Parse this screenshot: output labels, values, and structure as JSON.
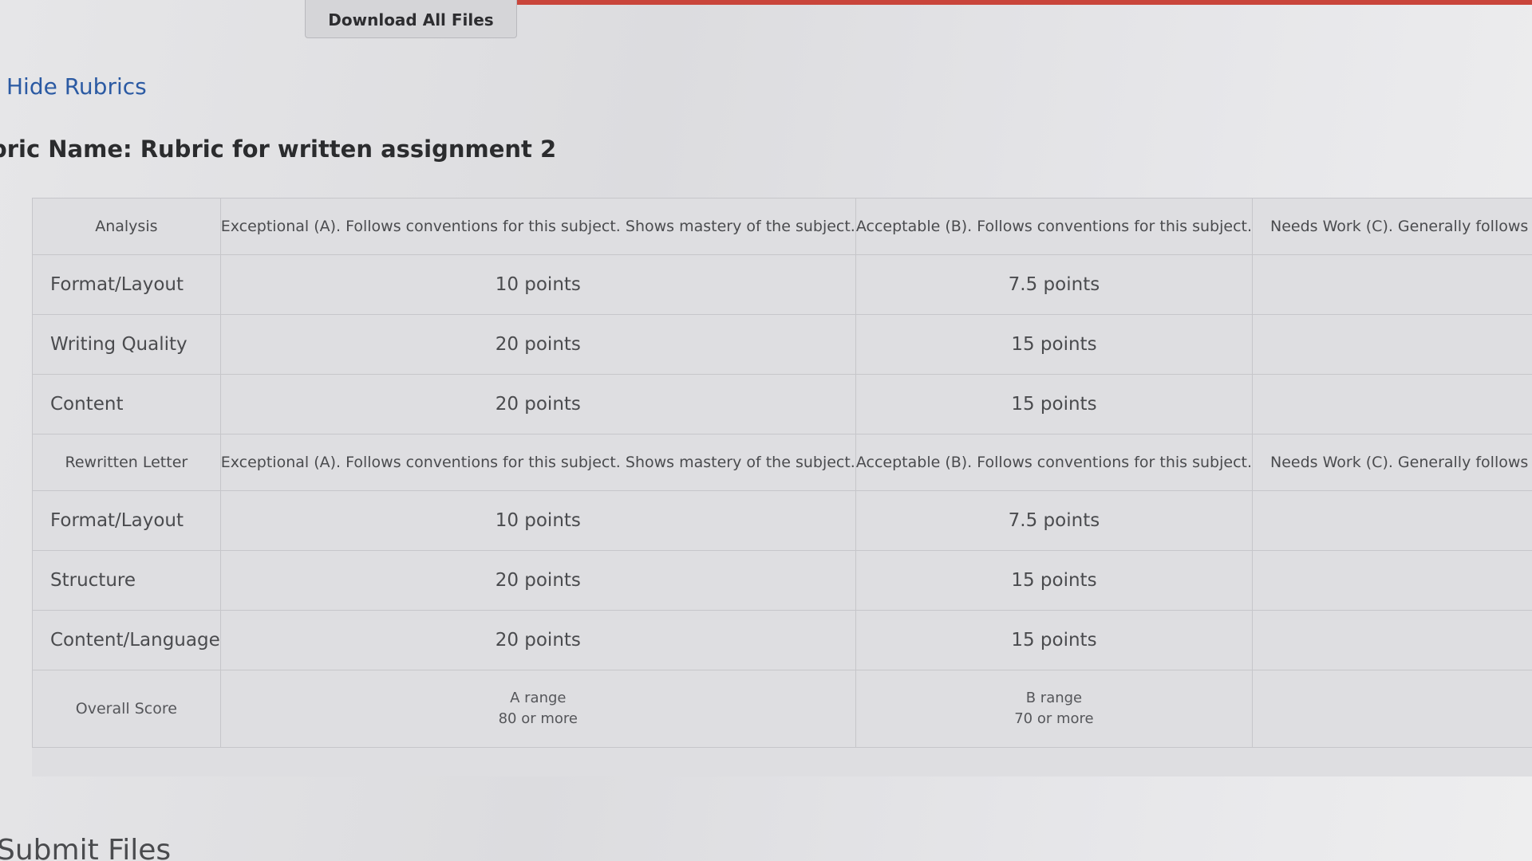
{
  "toolbar": {
    "download_label": "Download All Files"
  },
  "rubrics_toggle": {
    "label": "Hide Rubrics"
  },
  "rubric": {
    "name": "bric Name: Rubric for written assignment 2",
    "sections": [
      {
        "title": "Analysis",
        "levels": [
          "Exceptional (A). Follows conventions for this subject. Shows mastery of the subject.",
          "Acceptable (B). Follows conventions for this subject.",
          "Needs Work (C). Generally follows the c"
        ],
        "rows": [
          {
            "criterion": "Format/Layout",
            "scores": [
              "10 points",
              "7.5 points",
              ""
            ]
          },
          {
            "criterion": "Writing Quality",
            "scores": [
              "20 points",
              "15 points",
              ""
            ]
          },
          {
            "criterion": "Content",
            "scores": [
              "20 points",
              "15 points",
              ""
            ]
          }
        ]
      },
      {
        "title": "Rewritten Letter",
        "levels": [
          "Exceptional (A). Follows conventions for this subject. Shows mastery of the subject.",
          "Acceptable (B). Follows conventions for this subject.",
          "Needs Work (C). Generally follows the cor"
        ],
        "rows": [
          {
            "criterion": "Format/Layout",
            "scores": [
              "10 points",
              "7.5 points",
              ""
            ]
          },
          {
            "criterion": "Structure",
            "scores": [
              "20 points",
              "15 points",
              ""
            ]
          },
          {
            "criterion": "Content/Language",
            "scores": [
              "20 points",
              "15 points",
              ""
            ]
          }
        ]
      }
    ],
    "overall": {
      "label": "Overall Score",
      "ranges": [
        {
          "grade": "A range",
          "threshold": "80 or more"
        },
        {
          "grade": "B range",
          "threshold": "70 or more"
        },
        {
          "grade": "",
          "threshold": ""
        }
      ]
    }
  },
  "submit": {
    "heading": "Submit Files"
  }
}
